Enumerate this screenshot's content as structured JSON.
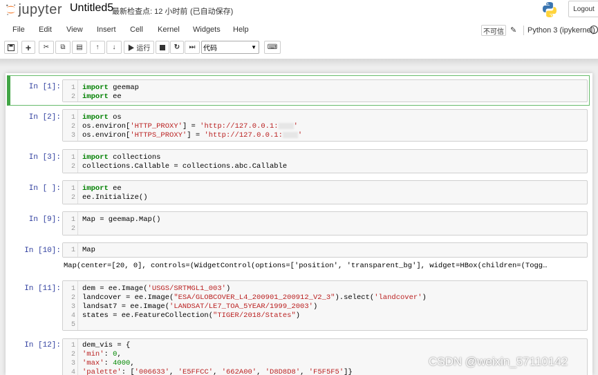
{
  "header": {
    "logo_text": "jupyter",
    "notebook_name": "Untitled5",
    "checkpoint": "最新检查点: 12 小时前",
    "autosave": "(已自动保存)",
    "logout_label": "Logout"
  },
  "menubar": {
    "items": [
      "File",
      "Edit",
      "View",
      "Insert",
      "Cell",
      "Kernel",
      "Widgets",
      "Help"
    ],
    "not_trusted": "不可信",
    "kernel_name": "Python 3 (ipykernel)"
  },
  "toolbar": {
    "run_label": "▶ 运行",
    "cell_type": "代码"
  },
  "cells": [
    {
      "prompt": "In  [1]:",
      "lines": [
        "import geemap",
        "import ee"
      ]
    },
    {
      "prompt": "In  [2]:",
      "lines": [
        "import os",
        "os.environ['HTTP_PROXY'] = 'http://127.0.0.1:",
        "os.environ['HTTPS_PROXY'] = 'http://127.0.0.1:"
      ]
    },
    {
      "prompt": "In  [3]:",
      "lines": [
        "import collections",
        "collections.Callable = collections.abc.Callable"
      ]
    },
    {
      "prompt": "In  [ ]:",
      "lines": [
        "import ee",
        "ee.Initialize()"
      ]
    },
    {
      "prompt": "In  [9]:",
      "lines": [
        "Map = geemap.Map()",
        ""
      ]
    },
    {
      "prompt": "In  [10]:",
      "lines": [
        "Map"
      ],
      "output": "Map(center=[20, 0], controls=(WidgetControl(options=['position', 'transparent_bg'], widget=HBox(children=(Togg…"
    },
    {
      "prompt": "In  [11]:",
      "lines": [
        "dem = ee.Image('USGS/SRTMGL1_003')",
        "landcover = ee.Image(\"ESA/GLOBCOVER_L4_200901_200912_V2_3\").select('landcover')",
        "landsat7 = ee.Image('LANDSAT/LE7_TOA_5YEAR/1999_2003')",
        "states = ee.FeatureCollection(\"TIGER/2018/States\")",
        ""
      ]
    },
    {
      "prompt": "In  [12]:",
      "lines": [
        "dem_vis = {",
        "'min': 0,",
        "'max': 4000,",
        "'palette': ['006633', 'E5FFCC', '662A00', 'D8D8D8', 'F5F5F5']}"
      ]
    }
  ],
  "watermark": "CSDN @weixin_57110142"
}
